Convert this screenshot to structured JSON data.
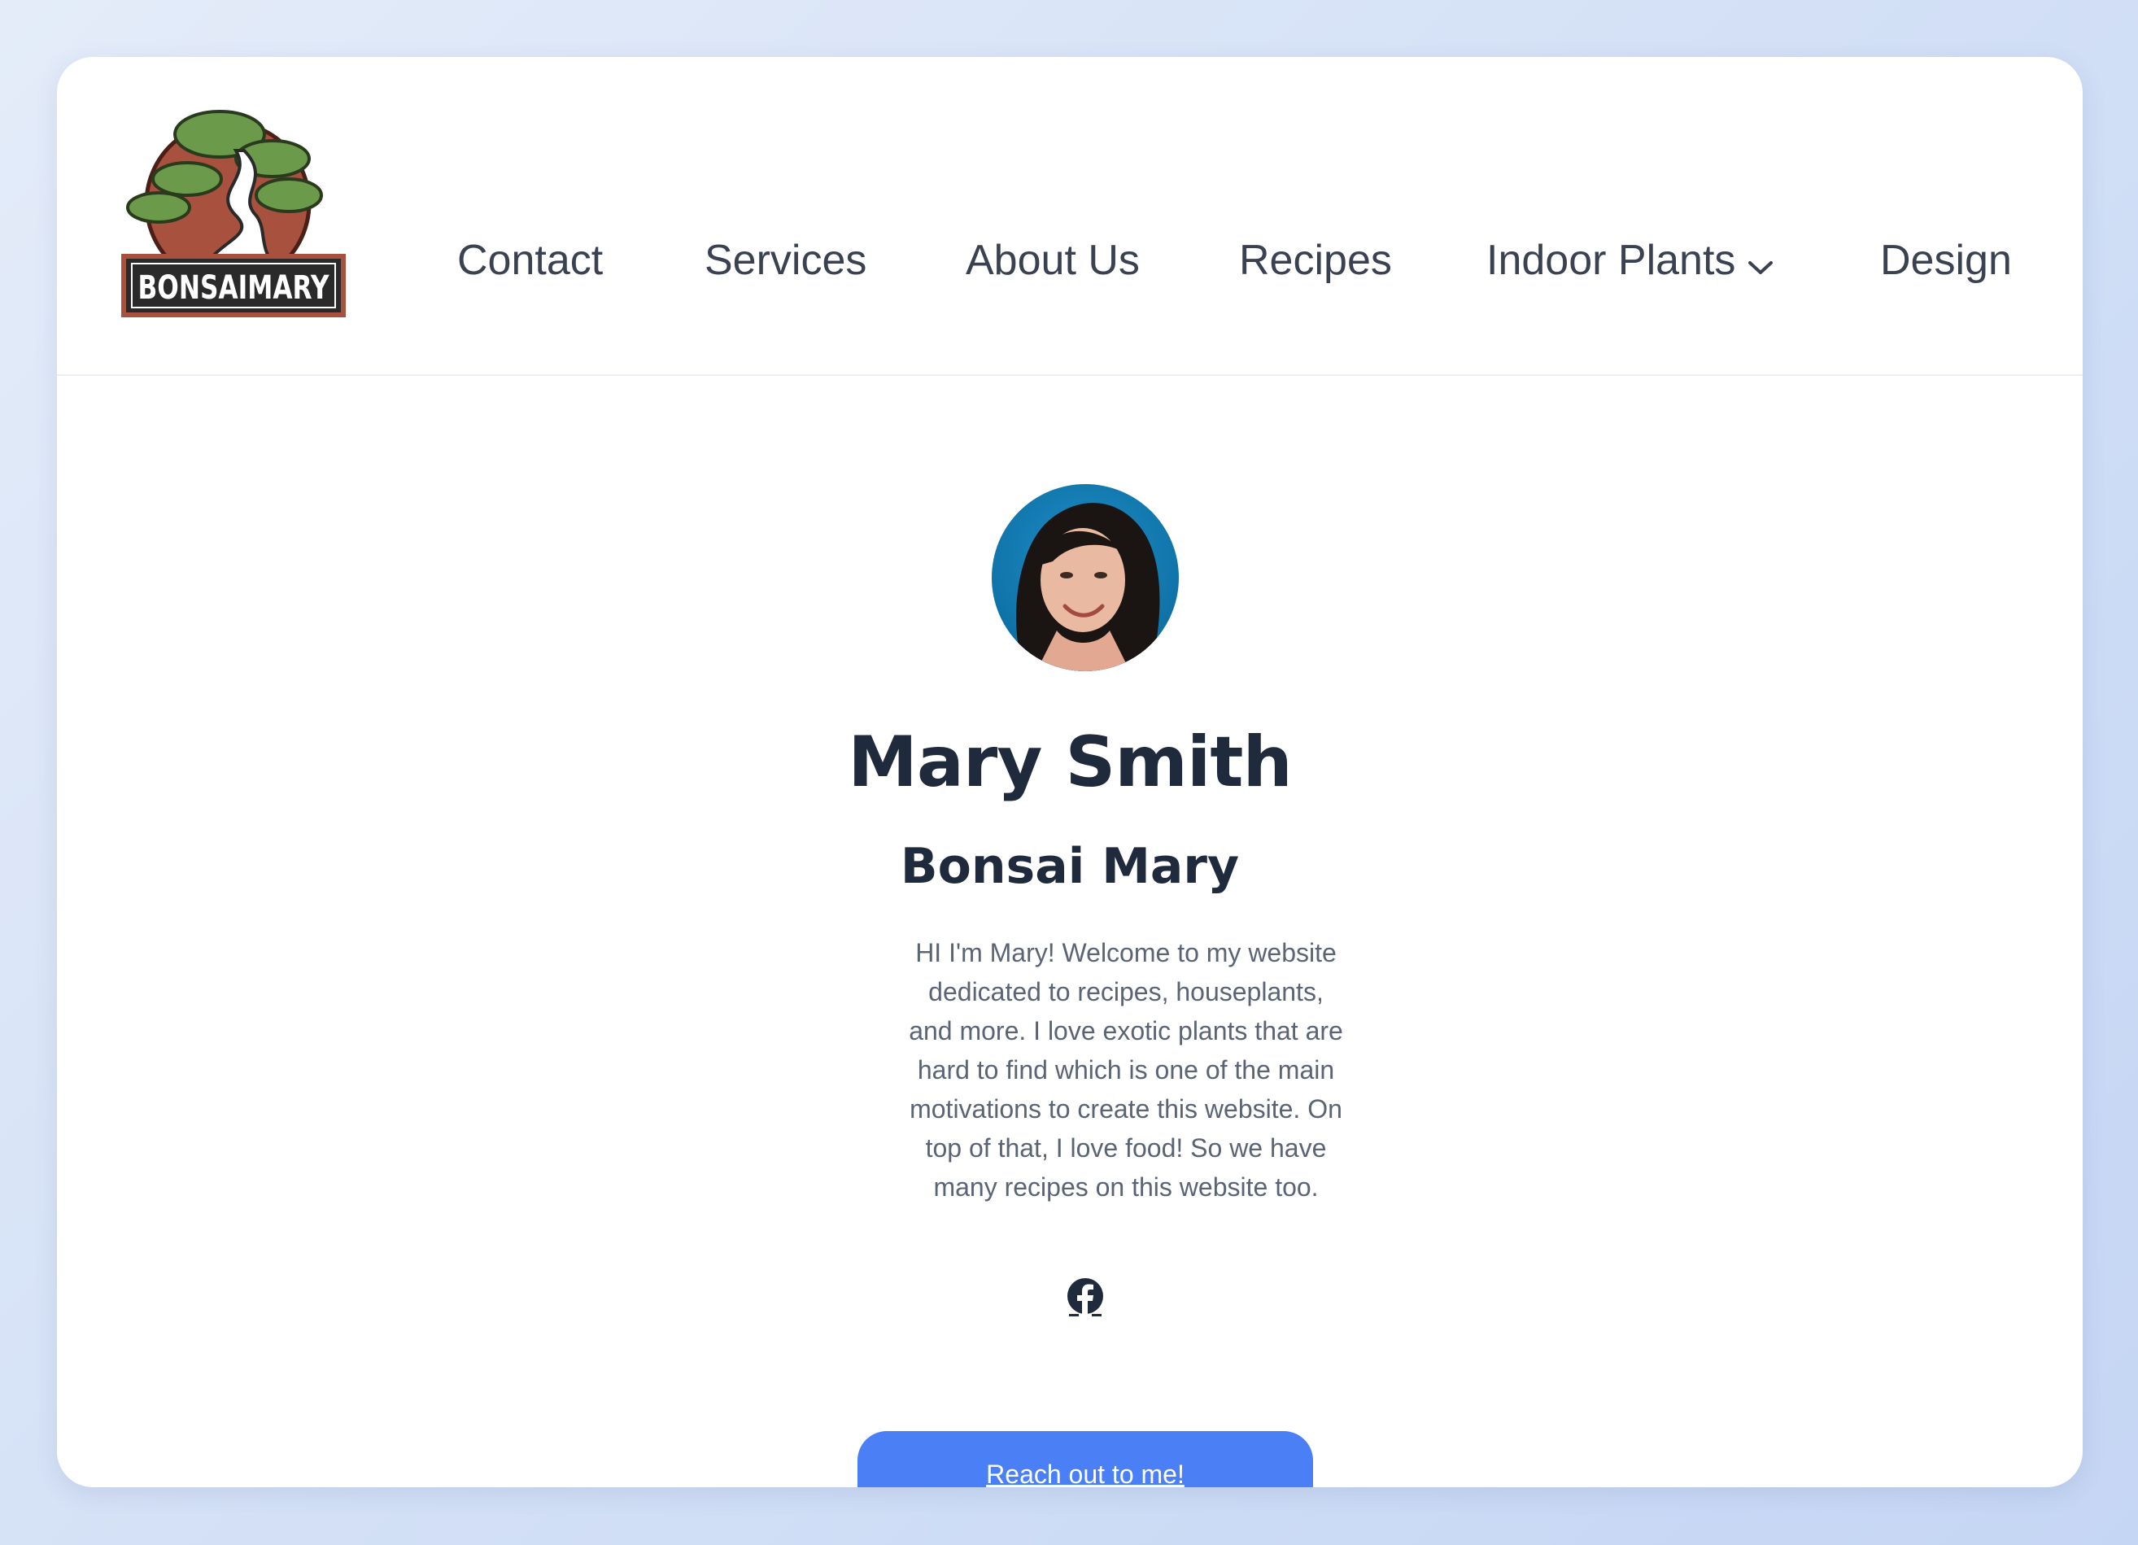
{
  "logo": {
    "text": "BONSAIMARY"
  },
  "nav": {
    "items": [
      {
        "label": "Contact"
      },
      {
        "label": "Services"
      },
      {
        "label": "About Us"
      },
      {
        "label": "Recipes"
      },
      {
        "label": "Indoor Plants",
        "has_dropdown": true
      },
      {
        "label": "Design"
      }
    ]
  },
  "profile": {
    "name": "Mary Smith",
    "subtitle": "Bonsai Mary",
    "bio": "HI I'm Mary! Welcome to my website dedicated to recipes, houseplants, and more. I love exotic plants that are hard to find which is one of the main motivations to create this website. On top of that, I love food! So we have many recipes on this website too."
  },
  "social": {
    "icon": "facebook-icon"
  },
  "cta": {
    "label": "Reach out to me!"
  },
  "colors": {
    "accent": "#4a7ff5",
    "text_dark": "#1f2a3c",
    "nav_text": "#3a4150",
    "body_text": "#5b6474"
  }
}
